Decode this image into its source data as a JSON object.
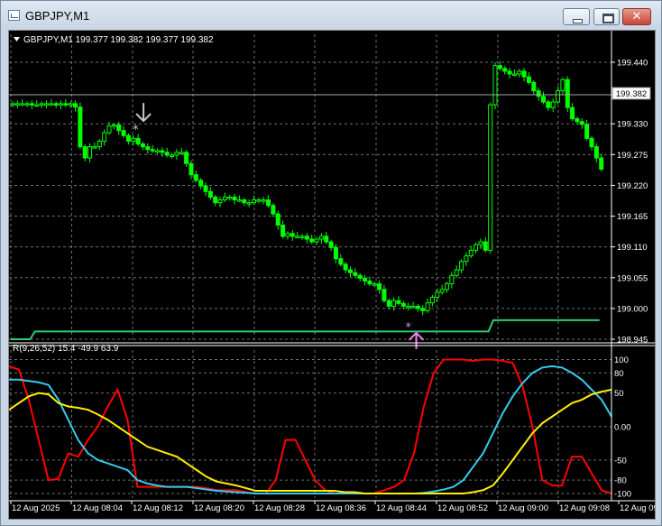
{
  "window": {
    "title": "GBPJPY,M1",
    "close_glyph": "✕"
  },
  "chart": {
    "header": "GBPJPY,M1  199.377 199.382 199.377 199.382",
    "current_price": "199.382",
    "price_ticks": [
      "199.440",
      "199.330",
      "199.275",
      "199.220",
      "199.165",
      "199.110",
      "199.055",
      "199.000",
      "198.945"
    ],
    "price_tick_values": [
      199.44,
      199.33,
      199.275,
      199.22,
      199.165,
      199.11,
      199.055,
      199.0,
      198.945
    ],
    "time_labels": [
      "12 Aug 2025",
      "12 Aug 08:04",
      "12 Aug 08:12",
      "12 Aug 08:20",
      "12 Aug 08:28",
      "12 Aug 08:36",
      "12 Aug 08:44",
      "12 Aug 08:52",
      "12 Aug 09:00",
      "12 Aug 09:08",
      "12 Aug 09:16"
    ],
    "sell_arrow_icon": "down-arrow-icon",
    "buy_arrow_icon": "up-arrow-icon",
    "colors": {
      "background": "#000000",
      "grid": "#6e6e6e",
      "candle": "#00ff00",
      "support_line": "#2ecc71",
      "price_line": "#a9a9a9",
      "sell_arrow": "#c8c8c8",
      "buy_arrow": "#ee82ee",
      "osc_red": "#ff0000",
      "osc_cyan": "#33ccee",
      "osc_yellow": "#ffee00"
    }
  },
  "indicator": {
    "header": "R(9,26,52) 15.4 -49.9 63.9",
    "ticks": [
      "100",
      "80",
      "50",
      "0.00",
      "-50",
      "-80",
      "-100"
    ],
    "tick_values": [
      100,
      80,
      50,
      0,
      -50,
      -80,
      -100
    ]
  },
  "chart_data": {
    "type": "line",
    "title": "GBPJPY,M1",
    "ylim": [
      198.94,
      199.48
    ],
    "closes": [
      199.366,
      199.366,
      199.366,
      199.366,
      199.364,
      199.364,
      199.366,
      199.366,
      199.366,
      199.364,
      199.366,
      199.364,
      199.366,
      199.36,
      199.289,
      199.269,
      199.289,
      199.289,
      199.299,
      199.314,
      199.326,
      199.328,
      199.318,
      199.309,
      199.299,
      199.304,
      199.294,
      199.289,
      199.284,
      199.282,
      199.282,
      199.279,
      199.274,
      199.274,
      199.279,
      199.279,
      199.259,
      199.239,
      199.229,
      199.219,
      199.209,
      199.199,
      199.189,
      199.194,
      199.199,
      199.199,
      199.194,
      199.194,
      199.189,
      199.189,
      199.194,
      199.194,
      199.194,
      199.184,
      199.169,
      199.149,
      199.129,
      199.134,
      199.129,
      199.129,
      199.129,
      199.124,
      199.119,
      199.124,
      199.129,
      199.119,
      199.109,
      199.089,
      199.079,
      199.069,
      199.064,
      199.059,
      199.054,
      199.049,
      199.044,
      199.044,
      199.034,
      199.014,
      199.004,
      199.014,
      199.009,
      199.004,
      199.004,
      199.004,
      199.0,
      198.996,
      199.01,
      199.02,
      199.029,
      199.034,
      199.044,
      199.059,
      199.069,
      199.084,
      199.094,
      199.104,
      199.114,
      199.119,
      199.104,
      199.364,
      199.434,
      199.429,
      199.424,
      199.419,
      199.419,
      199.424,
      199.414,
      199.404,
      199.389,
      199.379,
      199.369,
      199.359,
      199.369,
      199.389,
      199.409,
      199.359,
      199.339,
      199.334,
      199.329,
      199.304,
      199.289,
      199.269,
      199.249
    ],
    "sell_signal_index": 26,
    "buy_signal_index": 93,
    "support_line": [
      198.945,
      198.945,
      198.945,
      198.945,
      198.945,
      198.959,
      198.959,
      198.959,
      198.959,
      198.959,
      198.959,
      198.959,
      198.959,
      198.959,
      198.959,
      198.959,
      198.959,
      198.959,
      198.959,
      198.959,
      198.959,
      198.959,
      198.959,
      198.959,
      198.959,
      198.959,
      198.959,
      198.959,
      198.959,
      198.959,
      198.959,
      198.959,
      198.959,
      198.959,
      198.959,
      198.959,
      198.959,
      198.959,
      198.959,
      198.959,
      198.959,
      198.959,
      198.959,
      198.959,
      198.959,
      198.959,
      198.959,
      198.959,
      198.959,
      198.959,
      198.959,
      198.959,
      198.959,
      198.959,
      198.959,
      198.959,
      198.959,
      198.959,
      198.959,
      198.959,
      198.959,
      198.959,
      198.959,
      198.959,
      198.959,
      198.959,
      198.959,
      198.959,
      198.959,
      198.959,
      198.959,
      198.959,
      198.959,
      198.959,
      198.959,
      198.959,
      198.959,
      198.959,
      198.959,
      198.959,
      198.959,
      198.959,
      198.959,
      198.959,
      198.959,
      198.959,
      198.959,
      198.959,
      198.959,
      198.959,
      198.959,
      198.959,
      198.959,
      198.959,
      198.959,
      198.959,
      198.959,
      198.959,
      198.959,
      198.959,
      198.979,
      198.979,
      198.979,
      198.979,
      198.979,
      198.979,
      198.979,
      198.979,
      198.979,
      198.979,
      198.979,
      198.979,
      198.979,
      198.979,
      198.979,
      198.979,
      198.979,
      198.979,
      198.979,
      198.979,
      198.979,
      198.979,
      198.979
    ],
    "series": [
      {
        "name": "R(9)",
        "color": "#ff0000",
        "values": [
          90,
          85,
          40,
          -20,
          -80,
          -78,
          -40,
          -45,
          -20,
          0,
          30,
          55,
          10,
          -90,
          -90,
          -90,
          -90,
          -90,
          -90,
          -90,
          -92,
          -95,
          -95,
          -95,
          -98,
          -100,
          -100,
          -80,
          -20,
          -20,
          -50,
          -80,
          -95,
          -100,
          -100,
          -100,
          -100,
          -100,
          -95,
          -90,
          -80,
          -40,
          30,
          80,
          100,
          100,
          100,
          98,
          100,
          100,
          98,
          95,
          60,
          0,
          -80,
          -88,
          -88,
          -45,
          -45,
          -70,
          -95,
          -100
        ]
      },
      {
        "name": "R(26)",
        "color": "#33ccee",
        "values": [
          70,
          70,
          68,
          66,
          62,
          40,
          10,
          -20,
          -40,
          -50,
          -55,
          -60,
          -65,
          -80,
          -85,
          -88,
          -90,
          -90,
          -90,
          -92,
          -94,
          -96,
          -97,
          -98,
          -99,
          -100,
          -100,
          -100,
          -100,
          -100,
          -100,
          -100,
          -100,
          -100,
          -100,
          -100,
          -100,
          -100,
          -100,
          -100,
          -100,
          -100,
          -99,
          -97,
          -94,
          -90,
          -80,
          -60,
          -40,
          -10,
          20,
          45,
          65,
          80,
          88,
          90,
          88,
          80,
          70,
          55,
          40,
          15
        ]
      },
      {
        "name": "R(52)",
        "color": "#ffee00",
        "values": [
          25,
          35,
          45,
          50,
          48,
          35,
          30,
          28,
          25,
          18,
          10,
          0,
          -10,
          -20,
          -30,
          -35,
          -40,
          -45,
          -55,
          -65,
          -75,
          -82,
          -85,
          -88,
          -92,
          -96,
          -96,
          -96,
          -96,
          -96,
          -96,
          -96,
          -96,
          -96,
          -98,
          -98,
          -100,
          -100,
          -100,
          -100,
          -100,
          -100,
          -100,
          -100,
          -100,
          -100,
          -100,
          -98,
          -95,
          -88,
          -70,
          -50,
          -30,
          -10,
          5,
          15,
          25,
          35,
          40,
          48,
          52,
          55
        ]
      }
    ]
  }
}
